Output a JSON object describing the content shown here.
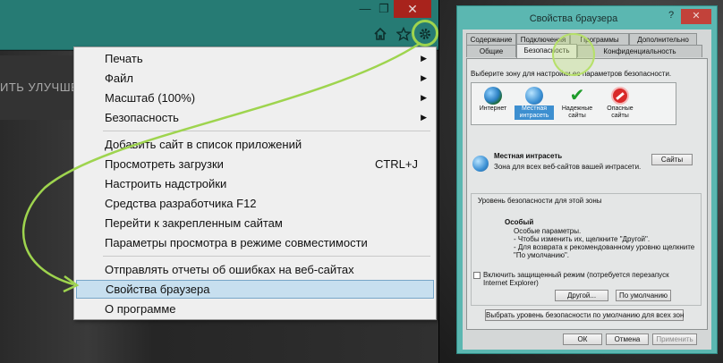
{
  "ie": {
    "page_banner_text": "ИТЬ УЛУЧШЕН",
    "titlebar": {
      "minimize": "—",
      "restore": "❐",
      "close": "✕"
    },
    "toolbar_icons": [
      "home-icon",
      "star-icon",
      "gear-icon"
    ],
    "menu": {
      "items": [
        {
          "label": "Печать",
          "submenu": true
        },
        {
          "label": "Файл",
          "submenu": true
        },
        {
          "label": "Масштаб (100%)",
          "submenu": true
        },
        {
          "label": "Безопасность",
          "submenu": true
        },
        {
          "label": "Добавить сайт в список приложений"
        },
        {
          "label": "Просмотреть загрузки",
          "shortcut": "CTRL+J"
        },
        {
          "label": "Настроить надстройки"
        },
        {
          "label": "Средства разработчика F12"
        },
        {
          "label": "Перейти к закрепленным сайтам"
        },
        {
          "label": "Параметры просмотра в режиме совместимости"
        },
        {
          "label": "Отправлять отчеты об ошибках на веб-сайтах"
        },
        {
          "label": "Свойства браузера",
          "selected": true
        },
        {
          "label": "О программе"
        }
      ]
    }
  },
  "dialog": {
    "title": "Свойства браузера",
    "help": "?",
    "close": "✕",
    "tabs_row1": [
      "Содержание",
      "Подключения",
      "Программы",
      "Дополнительно"
    ],
    "tabs_row2": [
      "Общие",
      "Безопасность",
      "Конфиденциальность"
    ],
    "active_tab": "Безопасность",
    "zone_prompt": "Выберите зону для настройки ее параметров безопасности.",
    "zones": [
      {
        "label1": "Интернет",
        "label2": "",
        "icon": "internet-globe-icon"
      },
      {
        "label1": "Местная",
        "label2": "интрасеть",
        "icon": "local-intranet-icon",
        "selected": true
      },
      {
        "label1": "Надежные",
        "label2": "сайты",
        "icon": "trusted-sites-checkmark-icon"
      },
      {
        "label1": "Опасные",
        "label2": "сайты",
        "icon": "restricted-sites-icon"
      }
    ],
    "zone_name": "Местная интрасеть",
    "zone_desc": "Зона для всех веб-сайтов вашей интрасети.",
    "sites_button": "Сайты",
    "security_level_title": "Уровень безопасности для этой зоны",
    "custom_title": "Особый",
    "custom_lines": [
      "Особые параметры.",
      "- Чтобы изменить их, щелкните \"Другой\".",
      "- Для возврата к рекомендованному уровню щелкните",
      "\"По умолчанию\"."
    ],
    "protected_mode_label1": "Включить защищенный режим (потребуется перезапуск",
    "protected_mode_label2": "Internet Explorer)",
    "custom_button": "Другой...",
    "default_button": "По умолчанию",
    "reset_all_button": "Выбрать уровень безопасности по умолчанию для всех зон",
    "ok": "ОК",
    "cancel": "Отмена",
    "apply": "Применить"
  }
}
